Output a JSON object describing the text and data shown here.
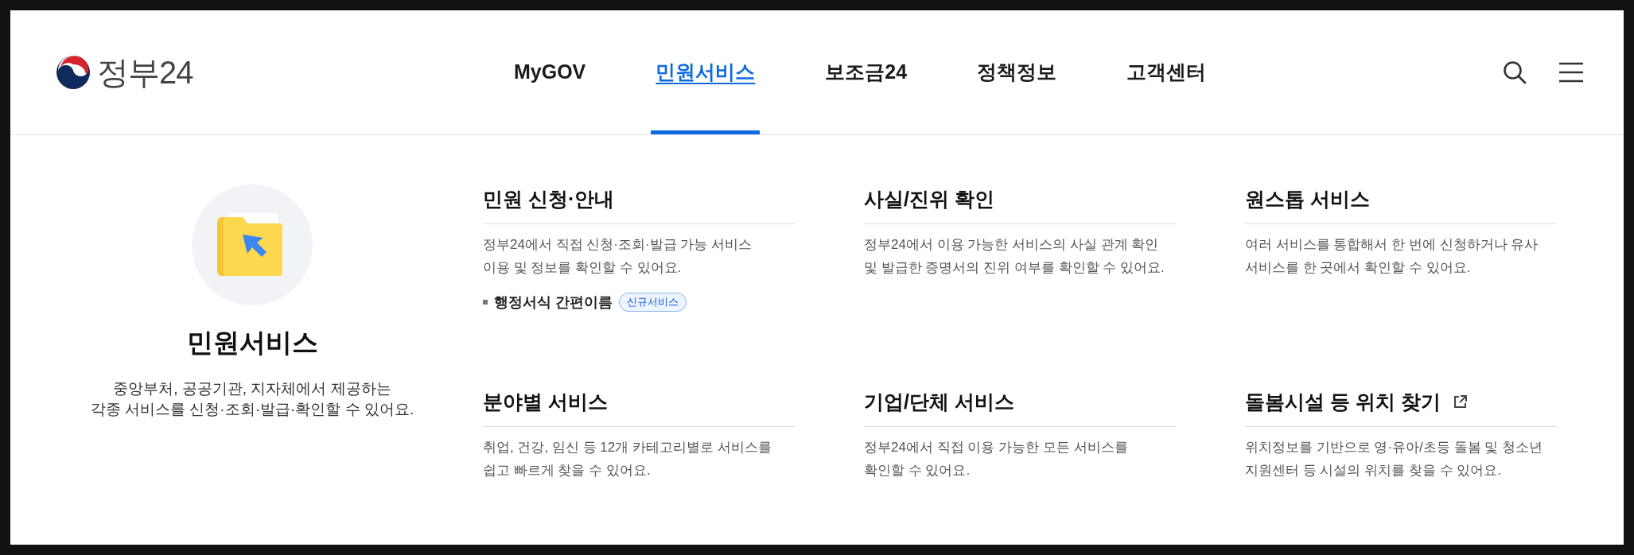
{
  "logo": {
    "text": "정부24"
  },
  "nav": [
    {
      "label": "MyGOV",
      "selected": false
    },
    {
      "label": "민원서비스",
      "selected": true
    },
    {
      "label": "보조금24",
      "selected": false
    },
    {
      "label": "정책정보",
      "selected": false
    },
    {
      "label": "고객센터",
      "selected": false
    }
  ],
  "panel": {
    "title": "민원서비스",
    "description_lines": [
      "중앙부처, 공공기관, 지자체에서 제공하는",
      "각종 서비스를 신청·조회·발급·확인할 수 있어요."
    ]
  },
  "sections": [
    {
      "title": "민원 신청·안내",
      "external": false,
      "description_lines": [
        "정부24에서 직접 신청·조회·발급 가능 서비스",
        "이용 및 정보를 확인할 수 있어요."
      ],
      "links": [
        {
          "label": "행정서식 간편이름",
          "badge": "신규서비스"
        }
      ]
    },
    {
      "title": "사실/진위 확인",
      "external": false,
      "description_lines": [
        "정부24에서 이용 가능한 서비스의 사실 관계 확인",
        "및 발급한 증명서의 진위 여부를 확인할 수 있어요."
      ]
    },
    {
      "title": "원스톱 서비스",
      "external": false,
      "description_lines": [
        "여러 서비스를 통합해서 한 번에 신청하거나 유사",
        "서비스를 한 곳에서 확인할 수 있어요."
      ]
    },
    {
      "title": "분야별 서비스",
      "external": false,
      "description_lines": [
        "취업, 건강, 임신 등 12개 카테고리별로 서비스를",
        "쉽고 빠르게 찾을 수 있어요."
      ]
    },
    {
      "title": "기업/단체 서비스",
      "external": false,
      "description_lines": [
        "정부24에서 직접 이용 가능한 모든 서비스를",
        "확인할 수 있어요."
      ]
    },
    {
      "title": "돌봄시설 등 위치 찾기",
      "external": true,
      "description_lines": [
        "위치정보를 기반으로 영·유아/초등 돌봄 및 청소년",
        "지원센터 등 시설의 위치를 찾을 수 있어요."
      ]
    }
  ]
}
